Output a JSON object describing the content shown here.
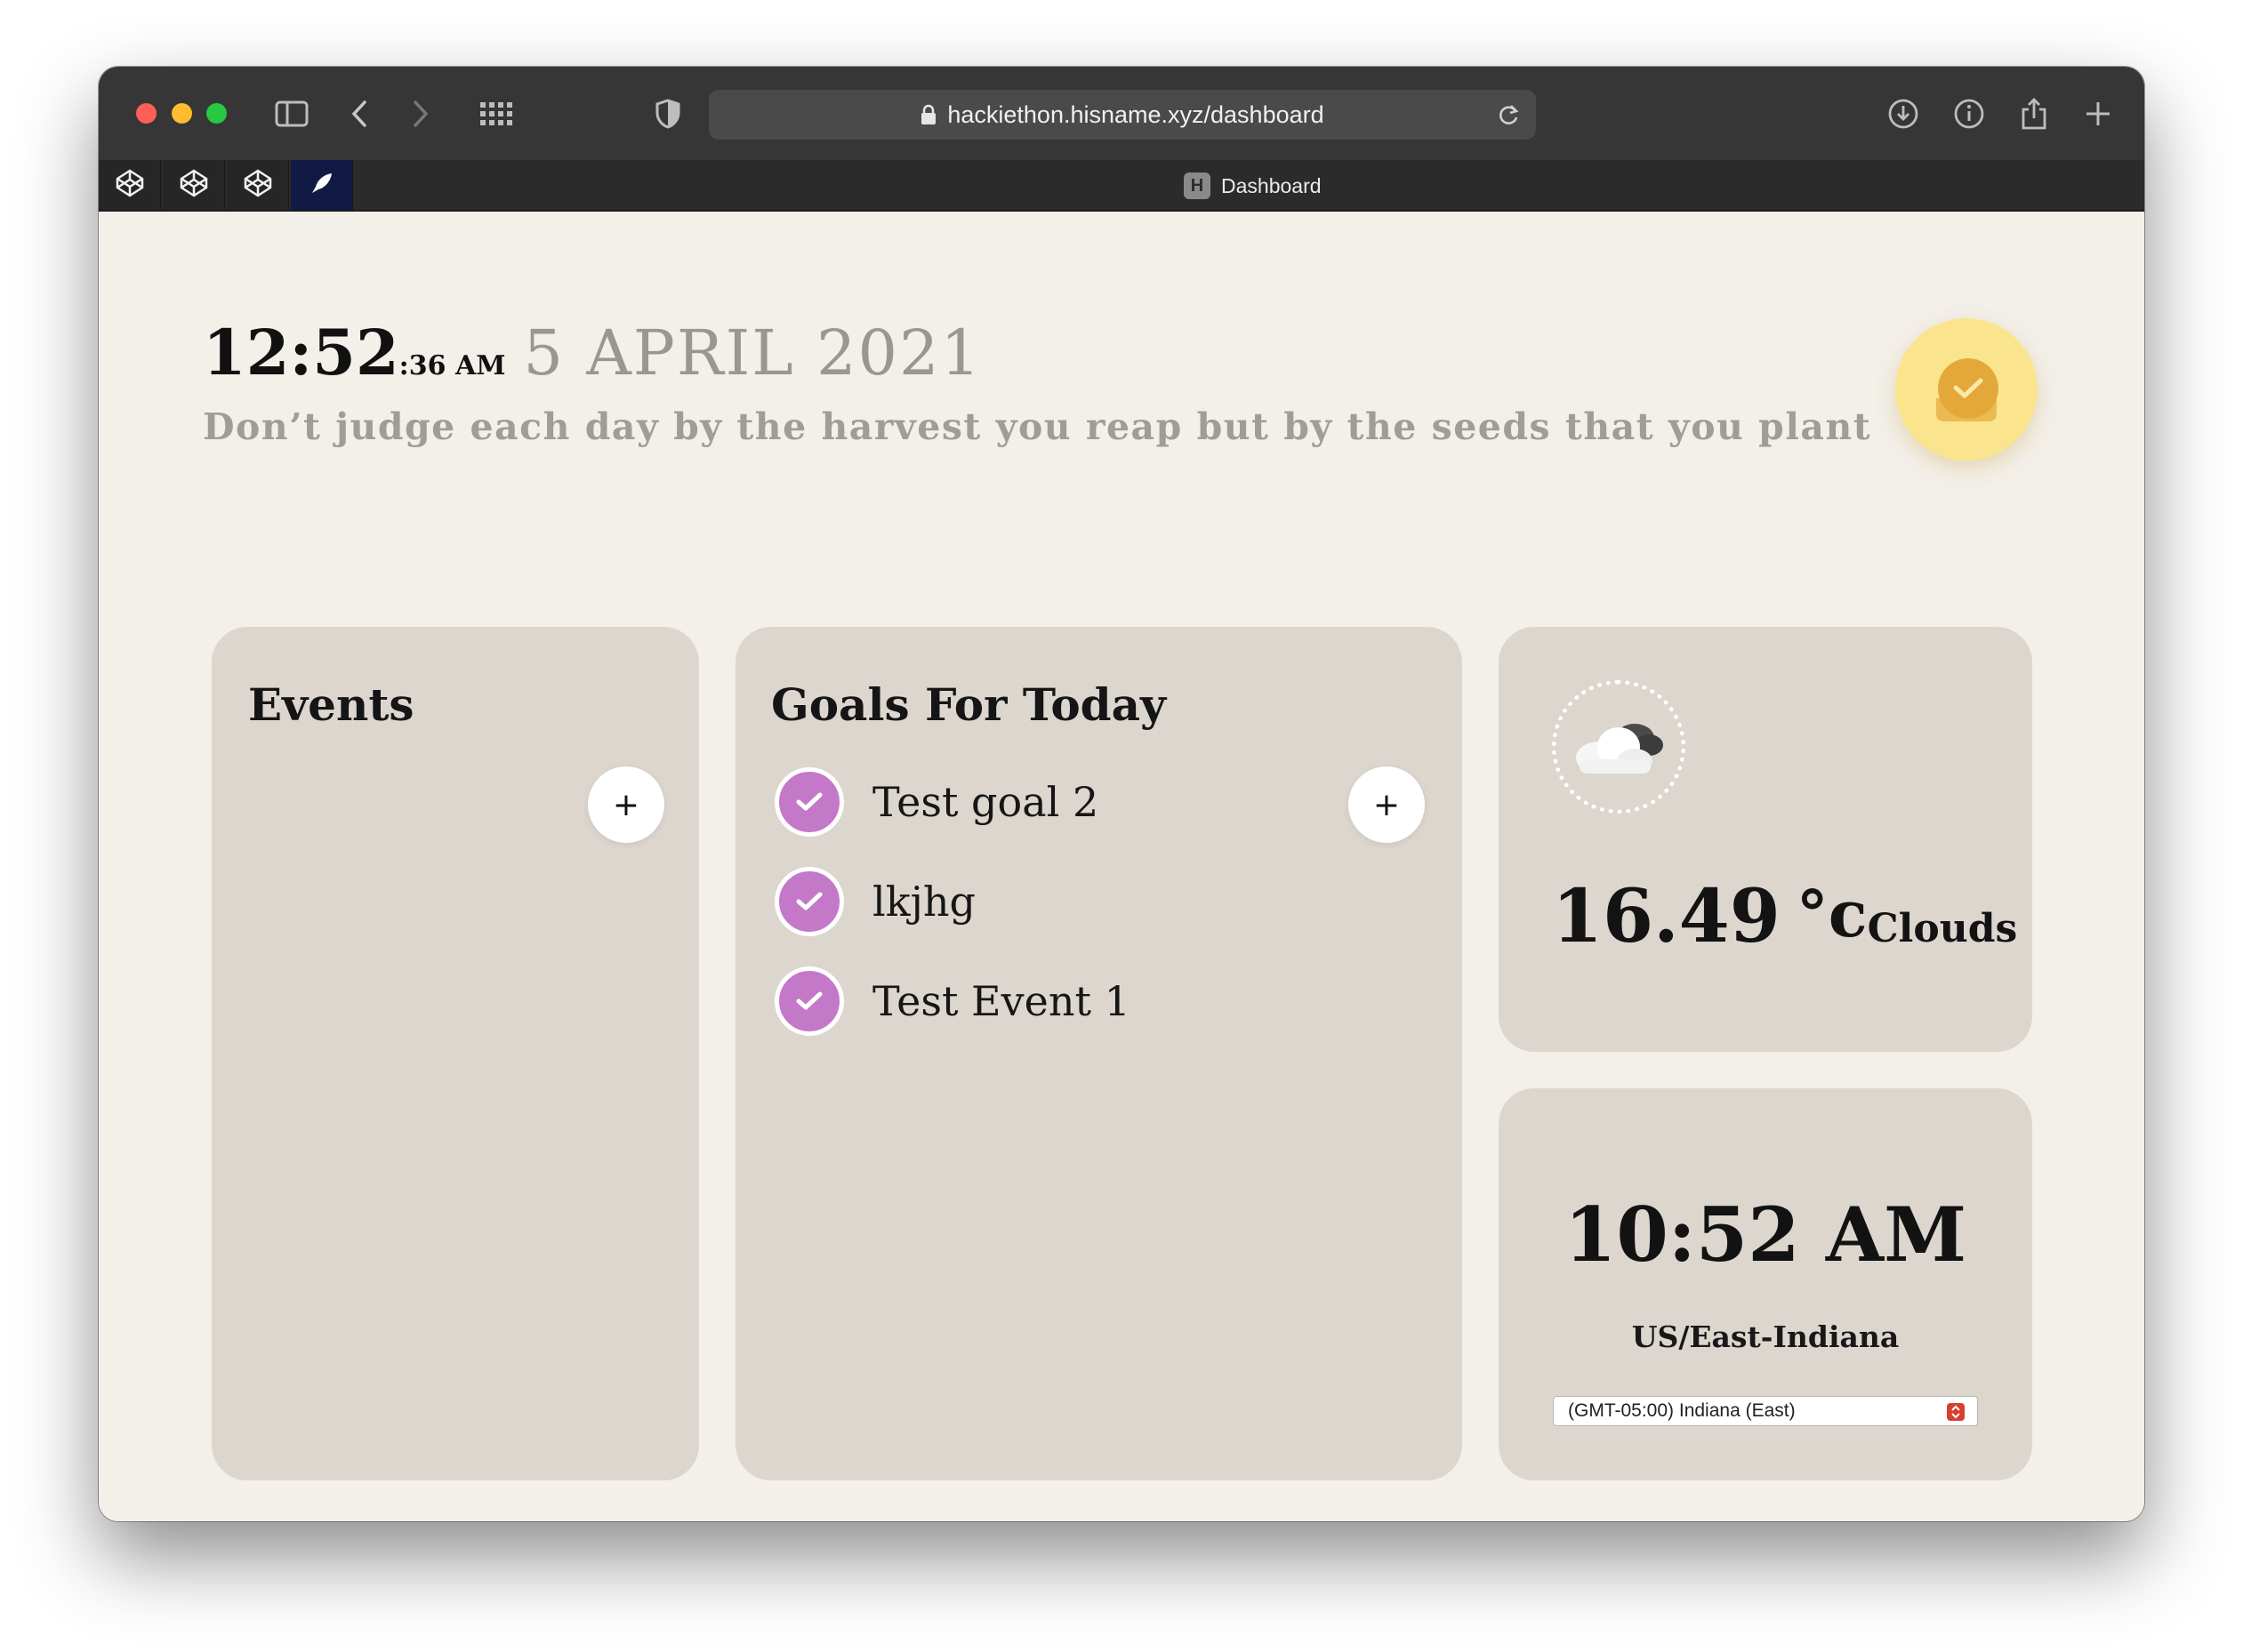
{
  "browser": {
    "url": "hackiethon.hisname.xyz/dashboard",
    "tab_title": "Dashboard",
    "tab_favicon_letter": "H"
  },
  "header": {
    "time_hm": "12:52",
    "time_seconds": ":36",
    "time_ampm": "AM",
    "date": "5 APRIL 2021",
    "quote": "Don’t judge each day by the harvest you reap but by the seeds that you plant"
  },
  "events": {
    "title": "Events",
    "add_label": "+"
  },
  "goals": {
    "title": "Goals For Today",
    "add_label": "+",
    "items": [
      {
        "text": "Test goal 2"
      },
      {
        "text": "lkjhg"
      },
      {
        "text": "Test Event 1"
      }
    ]
  },
  "weather": {
    "icon": "cloud-icon",
    "temperature": "16.49",
    "unit": "°c",
    "condition": "Clouds"
  },
  "timezone": {
    "time": "10:52 AM",
    "zone_name": "US/East-Indiana",
    "selected_option": "(GMT-05:00) Indiana (East)"
  },
  "colors": {
    "page_bg": "#f3efe9",
    "card_bg": "#dcd6cf",
    "goal_check": "#c379c7",
    "check_bubble": "#fae58e"
  }
}
